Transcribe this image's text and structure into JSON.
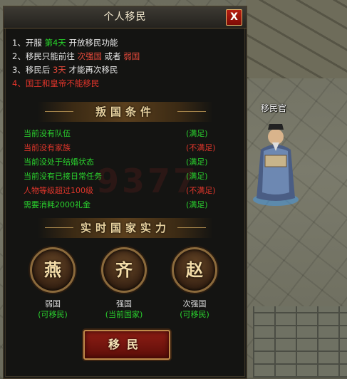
{
  "window": {
    "title": "个人移民",
    "close_label": "X"
  },
  "rules": [
    {
      "num": "1、",
      "parts": [
        {
          "t": "开服 ",
          "c": "w"
        },
        {
          "t": "第4天",
          "c": "g"
        },
        {
          "t": " 开放移民功能",
          "c": "w"
        }
      ]
    },
    {
      "num": "2、",
      "parts": [
        {
          "t": "移民只能前往 ",
          "c": "w"
        },
        {
          "t": "次强国",
          "c": "r"
        },
        {
          "t": " 或者 ",
          "c": "w"
        },
        {
          "t": "弱国",
          "c": "r"
        }
      ]
    },
    {
      "num": "3、",
      "parts": [
        {
          "t": "移民后 ",
          "c": "w"
        },
        {
          "t": "3天",
          "c": "r"
        },
        {
          "t": " 才能再次移民",
          "c": "w"
        }
      ]
    },
    {
      "num": "4、",
      "parts": [
        {
          "t": "国王和皇帝不能移民",
          "c": "red"
        }
      ]
    }
  ],
  "section_conditions": "叛国条件",
  "conditions": [
    {
      "text": "当前没有队伍",
      "status": "(满足)",
      "ok": true
    },
    {
      "text": "当前没有家族",
      "status": "(不满足)",
      "ok": false
    },
    {
      "text": "当前没处于结婚状态",
      "status": "(满足)",
      "ok": true
    },
    {
      "text": "当前没有已接日常任务",
      "status": "(满足)",
      "ok": true
    },
    {
      "text": "人物等级超过100级",
      "status": "(不满足)",
      "ok": false
    },
    {
      "text": "需要消耗2000礼金",
      "status": "(满足)",
      "ok": true
    }
  ],
  "section_strength": "实时国家实力",
  "nations": [
    {
      "char": "燕",
      "name": "弱国",
      "status": "(可移民)"
    },
    {
      "char": "齐",
      "name": "强国",
      "status": "(当前国家)"
    },
    {
      "char": "赵",
      "name": "次强国",
      "status": "(可移民)"
    }
  ],
  "migrate_button": "移民",
  "npc": {
    "label": "移民官"
  },
  "watermark": "9377",
  "colors": {
    "ok": "#2ad22e",
    "fail": "#e0362b",
    "panel_bg": "#141412",
    "accent_gold": "#c08a4a"
  }
}
